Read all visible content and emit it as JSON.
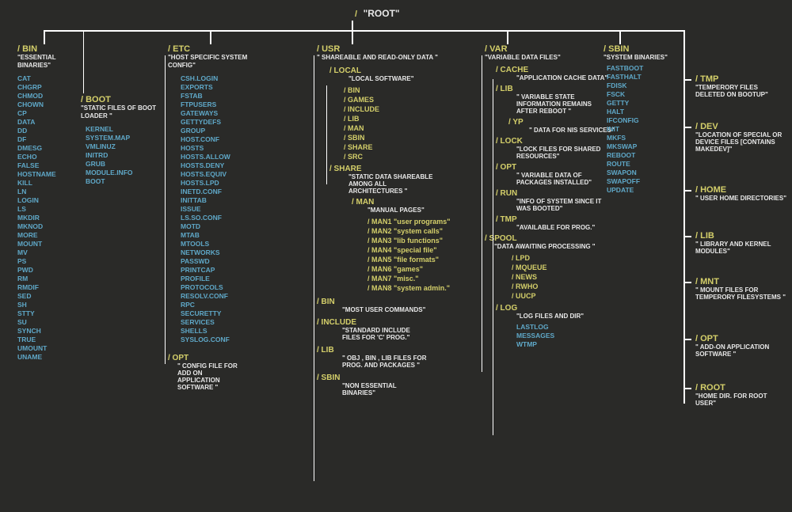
{
  "root": {
    "label": "/",
    "name": "\"ROOT\""
  },
  "bin": {
    "label": "/ BIN",
    "desc": "\"ESSENTIAL BINARIES\"",
    "items": [
      "CAT",
      "CHGRP",
      "CHMOD",
      "CHOWN",
      "CP",
      "DATA",
      "DD",
      "DF",
      "DMESG",
      "ECHO",
      "FALSE",
      "HOSTNAME",
      "KILL",
      "LN",
      "LOGIN",
      "LS",
      "MKDIR",
      "MKNOD",
      "MORE",
      "MOUNT",
      "MV",
      "PS",
      "PWD",
      "RM",
      "RMDIF",
      "SED",
      "SH",
      "STTY",
      "SU",
      "SYNCH",
      "TRUE",
      "UMOUNT",
      "UNAME"
    ]
  },
  "boot": {
    "label": "/ BOOT",
    "desc": "\"STATIC FILES OF BOOT LOADER \"",
    "items": [
      "KERNEL",
      "SYSTEM.MAP",
      "VMLINUZ",
      "INITRD",
      "GRUB",
      "MODULE.INFO",
      "BOOT"
    ]
  },
  "etc": {
    "label": "/ ETC",
    "desc": "\"HOST SPECIFIC SYSTEM CONFIG\"",
    "items": [
      "CSH.LOGIN",
      "EXPORTS",
      "FSTAB",
      "FTPUSERS",
      "GATEWAYS",
      "GETTYDEFS",
      "GROUP",
      "HOST.CONF",
      "HOSTS",
      "HOSTS.ALLOW",
      "HOSTS.DENY",
      "HOSTS.EQUIV",
      "HOSTS.LPD",
      "INETD.CONF",
      "INITTAB",
      "ISSUE",
      "LS.SO.CONF",
      "MOTD",
      "MTAB",
      "MTOOLS",
      "NETWORKS",
      "PASSWD",
      "PRINTCAP",
      "PROFILE",
      "PROTOCOLS",
      "RESOLV.CONF",
      "RPC",
      "SECURETTY",
      "SERVICES",
      "SHELLS",
      "SYSLOG.CONF"
    ]
  },
  "opt": {
    "label": "/ OPT",
    "desc": "\" CONFIG FILE FOR ADD ON APPLICATION SOFTWARE \""
  },
  "usr": {
    "label": "/ USR",
    "desc": "\" SHAREABLE AND READ-ONLY DATA \"",
    "local": {
      "label": "/ LOCAL",
      "desc": "\"LOCAL SOFTWARE\"",
      "items": [
        "/ BIN",
        "/ GAMES",
        "/ INCLUDE",
        "/ LIB",
        "/ MAN",
        "/ SBIN",
        "/ SHARE",
        "/ SRC"
      ]
    },
    "share": {
      "label": "/ SHARE",
      "desc": "\"STATIC DATA SHAREABLE AMONG ALL ARCHITECTURES \"",
      "man": {
        "label": "/ MAN",
        "desc": "\"MANUAL PAGES\"",
        "items": [
          "/ MAN1 \"user programs\"",
          "/ MAN2 \"system calls\"",
          "/ MAN3 \"lib functions\"",
          "/ MAN4 \"special file\"",
          "/ MAN5 \"file formats\"",
          "/ MAN6 \"games\"",
          "/ MAN7 \"misc.\"",
          "/ MAN8 \"system admin.\""
        ]
      }
    },
    "binsub": {
      "label": "/ BIN",
      "desc": "\"MOST USER COMMANDS\""
    },
    "include": {
      "label": "/ INCLUDE",
      "desc": "\"STANDARD INCLUDE FILES FOR  'C' PROG.\""
    },
    "lib": {
      "label": "/ LIB",
      "desc": "\" OBJ , BIN , LIB FILES FOR PROG. AND PACKAGES \""
    },
    "sbin": {
      "label": "/ SBIN",
      "desc": "\"NON ESSENTIAL BINARIES\""
    }
  },
  "var": {
    "label": "/ VAR",
    "desc": "\"VARIABLE DATA FILES\"",
    "cache": {
      "label": "/ CACHE",
      "desc": "\"APPLICATION CACHE DATA\""
    },
    "lib": {
      "label": "/ LIB",
      "desc": "\" VARIABLE STATE INFORMATION REMAINS  AFTER REBOOT \""
    },
    "yp": {
      "label": "/ YP",
      "desc": "\" DATA FOR NIS SERVICES\""
    },
    "lock": {
      "label": "/ LOCK",
      "desc": "\"LOCK FILES FOR SHARED RESOURCES\""
    },
    "opt": {
      "label": "/ OPT",
      "desc": "\" VARIABLE DATA OF PACKAGES INSTALLED\""
    },
    "run": {
      "label": "/ RUN",
      "desc": "\"INFO OF SYSTEM SINCE IT WAS BOOTED\""
    },
    "tmp": {
      "label": "/ TMP",
      "desc": "\"AVAILABLE FOR PROG.\""
    },
    "spool": {
      "label": "/ SPOOL",
      "desc": "\"DATA AWAITING PROCESSING \"",
      "items": [
        "/ LPD",
        "/ MQUEUE",
        "/ NEWS",
        "/ RWHO",
        "/ UUCP"
      ]
    },
    "log": {
      "label": "/ LOG",
      "desc": "\"LOG FILES AND DIR\"",
      "items": [
        "LASTLOG",
        "MESSAGES",
        "WTMP"
      ]
    }
  },
  "sbin": {
    "label": "/ SBIN",
    "desc": "\"SYSTEM BINARIES\"",
    "items": [
      "FASTBOOT",
      "FASTHALT",
      "FDISK",
      "FSCK",
      "GETTY",
      "HALT",
      "IFCONFIG",
      "INIT",
      "MKFS",
      "MKSWAP",
      "REBOOT",
      "ROUTE",
      "SWAPON",
      "SWAPOFF",
      "UPDATE"
    ]
  },
  "tmp": {
    "label": "/ TMP",
    "desc": "\"TEMPERORY FILES DELETED ON BOOTUP\""
  },
  "dev": {
    "label": "/ DEV",
    "desc": "\"LOCATION OF SPECIAL OR DEVICE FILES [CONTAINS MAKEDEV]\""
  },
  "home": {
    "label": "/ HOME",
    "desc": "\" USER HOME DIRECTORIES\""
  },
  "toplib": {
    "label": "/ LIB",
    "desc": "\" LIBRARY AND KERNEL MODULES\""
  },
  "mnt": {
    "label": "/ MNT",
    "desc": "\"  MOUNT FILES FOR TEMPERORY FILESYSTEMS \""
  },
  "topopt": {
    "label": "/ OPT",
    "desc": "\" ADD-ON APPLICATION SOFTWARE \""
  },
  "rootdir": {
    "label": "/ ROOT",
    "desc": "\"HOME DIR. FOR ROOT USER\""
  }
}
